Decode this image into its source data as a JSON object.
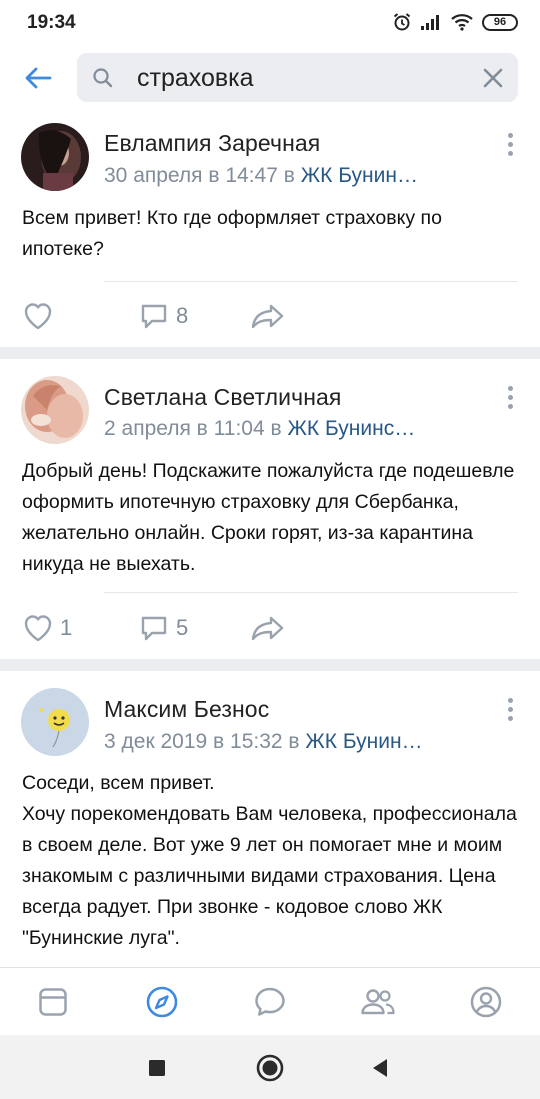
{
  "status_bar": {
    "time": "19:34",
    "battery": "96",
    "icons": [
      "alarm-icon",
      "signal-icon",
      "wifi-icon",
      "battery-icon"
    ]
  },
  "header": {
    "back_icon": "back-arrow-icon",
    "search": {
      "value": "страховка",
      "icon": "search-icon",
      "clear_icon": "clear-icon"
    }
  },
  "posts": [
    {
      "author": "Евлампия Заречная",
      "date": "30 апреля в 14:47 в",
      "group": "ЖК Бунин…",
      "text": "Всем привет! Кто где оформляет страховку по ипотеке?",
      "likes": "",
      "comments": "8"
    },
    {
      "author": "Светлана Светличная",
      "date": "2 апреля в 11:04 в",
      "group": "ЖК Бунинс…",
      "text": "Добрый день! Подскажите пожалуйста где подешевле оформить ипотечную страховку для Сбербанка, желательно онлайн. Сроки горят, из-за карантина никуда не выехать.",
      "likes": "1",
      "comments": "5"
    },
    {
      "author": "Максим Безнос",
      "date": "3 дек 2019 в 15:32 в",
      "group": "ЖК Бунин…",
      "text_lines": [
        "Соседи, всем привет.",
        "Хочу порекомендовать Вам человека, профессионала в своем деле. Вот уже 9 лет он помогает мне и моим знакомым с различными видами страхования. Цена всегда радует. При звонке - кодовое слово ЖК \"Бунинские луга\"."
      ]
    }
  ],
  "tabbar": {
    "tabs": [
      "news-icon",
      "discover-icon",
      "messages-icon",
      "friends-icon",
      "profile-icon"
    ],
    "active": "discover-icon",
    "accent": "#3f8ae0",
    "inactive": "#99a2ad"
  },
  "navbar": {
    "buttons": [
      "recents-square-icon",
      "home-circle-icon",
      "back-triangle-icon"
    ]
  }
}
